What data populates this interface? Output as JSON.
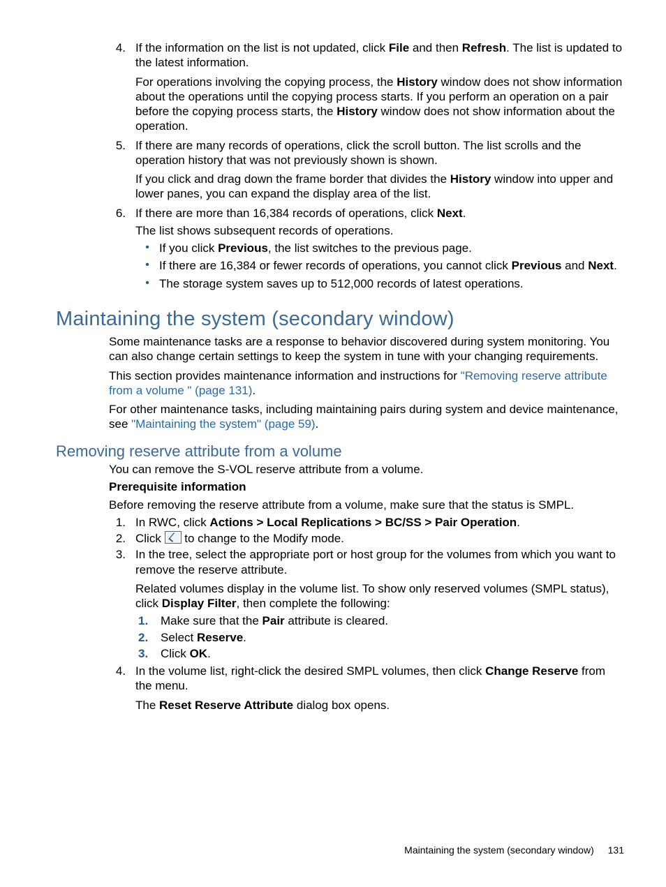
{
  "top_list": {
    "item4": {
      "num": "4.",
      "p1": {
        "pre": "If the information on the list is not updated, click ",
        "b1": "File",
        "mid": " and then ",
        "b2": "Refresh",
        "post": ". The list is updated to the latest information."
      },
      "p2": {
        "pre": "For operations involving the copying process, the ",
        "b1": "History",
        "mid": " window does not show information about the operations until the copying process starts. If you perform an operation on a pair before the copying process starts, the ",
        "b2": "History",
        "post": " window does not show information about the operation."
      }
    },
    "item5": {
      "num": "5.",
      "p1": "If there are many records of operations, click the scroll button. The list scrolls and the operation history that was not previously shown is shown.",
      "p2": {
        "pre": "If you click and drag down the frame border that divides the ",
        "b1": "History",
        "post": " window into upper and lower panes, you can expand the display area of the list."
      }
    },
    "item6": {
      "num": "6.",
      "p1": {
        "pre": "If there are more than 16,384 records of operations, click ",
        "b1": "Next",
        "post": "."
      },
      "p2": "The list shows subsequent records of operations.",
      "bullets": {
        "b1": {
          "pre": "If you click ",
          "bold": "Previous",
          "post": ", the list switches to the previous page."
        },
        "b2": {
          "pre": "If there are 16,384 or fewer records of operations, you cannot click ",
          "bold1": "Previous",
          "mid": " and ",
          "bold2": "Next",
          "post": "."
        },
        "b3": "The storage system saves up to 512,000 records of latest operations."
      }
    }
  },
  "section": {
    "title": "Maintaining the system (secondary window)",
    "p1": "Some maintenance tasks are a response to behavior discovered during system monitoring. You can also change certain settings to keep the system in tune with your changing requirements.",
    "p2": {
      "pre": "This section provides maintenance information and instructions for ",
      "link": "\"Removing reserve attribute from a volume \" (page 131)",
      "post": "."
    },
    "p3": {
      "pre": "For other maintenance tasks, including maintaining pairs during system and device maintenance, see ",
      "link": "\"Maintaining the system\" (page 59)",
      "post": "."
    }
  },
  "subsection": {
    "title": "Removing reserve attribute from a volume",
    "p1": "You can remove the S-VOL reserve attribute from a volume.",
    "prereq_label": "Prerequisite information",
    "p2": "Before removing the reserve attribute from a volume, make sure that the status is SMPL.",
    "steps": {
      "s1": {
        "num": "1.",
        "pre": "In RWC, click ",
        "bold": "Actions > Local Replications > BC/SS > Pair Operation",
        "post": "."
      },
      "s2": {
        "num": "2.",
        "pre": "Click ",
        "post": " to change to the Modify mode."
      },
      "s3": {
        "num": "3.",
        "p1": "In the tree, select the appropriate port or host group for the volumes from which you want to remove the reserve attribute.",
        "p2": {
          "pre": "Related volumes display in the volume list. To show only reserved volumes (SMPL status), click ",
          "bold": "Display Filter",
          "post": ", then complete the following:"
        },
        "sub": {
          "a": {
            "num": "1.",
            "pre": "Make sure that the ",
            "bold": "Pair",
            "post": " attribute is cleared."
          },
          "b": {
            "num": "2.",
            "pre": "Select ",
            "bold": "Reserve",
            "post": "."
          },
          "c": {
            "num": "3.",
            "pre": "Click ",
            "bold": "OK",
            "post": "."
          }
        }
      },
      "s4": {
        "num": "4.",
        "p1": {
          "pre": "In the volume list, right-click the desired SMPL volumes, then click ",
          "bold": "Change Reserve",
          "post": " from the menu."
        },
        "p2": {
          "pre": "The ",
          "bold": "Reset Reserve Attribute",
          "post": " dialog box opens."
        }
      }
    }
  },
  "footer": {
    "text": "Maintaining the system (secondary window)",
    "page": "131"
  }
}
